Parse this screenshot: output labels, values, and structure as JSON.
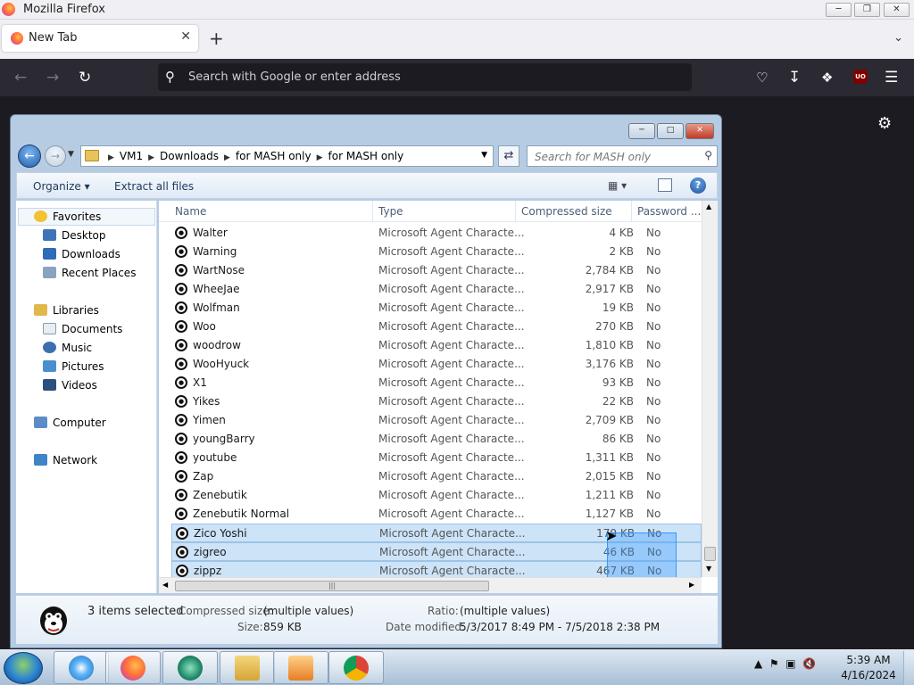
{
  "firefox": {
    "window_title": "Mozilla Firefox",
    "tab_label": "New Tab",
    "url_placeholder": "Search with Google or enter address",
    "ublock_badge": "UO"
  },
  "explorer": {
    "breadcrumbs": [
      "VM1",
      "Downloads",
      "for MASH only",
      "for MASH only"
    ],
    "search_placeholder": "Search for MASH only",
    "toolbar": {
      "organize": "Organize",
      "extract_all": "Extract all files"
    },
    "nav": {
      "favorites": "Favorites",
      "desktop": "Desktop",
      "downloads": "Downloads",
      "recent_places": "Recent Places",
      "libraries": "Libraries",
      "documents": "Documents",
      "music": "Music",
      "pictures": "Pictures",
      "videos": "Videos",
      "computer": "Computer",
      "network": "Network"
    },
    "columns": {
      "name": "Name",
      "type": "Type",
      "compressed_size": "Compressed size",
      "password": "Password ..."
    },
    "files": [
      {
        "name": "Walter",
        "type": "Microsoft Agent Characte...",
        "size": "4 KB",
        "password": "No"
      },
      {
        "name": "Warning",
        "type": "Microsoft Agent Characte...",
        "size": "2 KB",
        "password": "No"
      },
      {
        "name": "WartNose",
        "type": "Microsoft Agent Characte...",
        "size": "2,784 KB",
        "password": "No"
      },
      {
        "name": "WheeJae",
        "type": "Microsoft Agent Characte...",
        "size": "2,917 KB",
        "password": "No"
      },
      {
        "name": "Wolfman",
        "type": "Microsoft Agent Characte...",
        "size": "19 KB",
        "password": "No"
      },
      {
        "name": "Woo",
        "type": "Microsoft Agent Characte...",
        "size": "270 KB",
        "password": "No"
      },
      {
        "name": "woodrow",
        "type": "Microsoft Agent Characte...",
        "size": "1,810 KB",
        "password": "No"
      },
      {
        "name": "WooHyuck",
        "type": "Microsoft Agent Characte...",
        "size": "3,176 KB",
        "password": "No"
      },
      {
        "name": "X1",
        "type": "Microsoft Agent Characte...",
        "size": "93 KB",
        "password": "No"
      },
      {
        "name": "Yikes",
        "type": "Microsoft Agent Characte...",
        "size": "22 KB",
        "password": "No"
      },
      {
        "name": "Yimen",
        "type": "Microsoft Agent Characte...",
        "size": "2,709 KB",
        "password": "No"
      },
      {
        "name": "youngBarry",
        "type": "Microsoft Agent Characte...",
        "size": "86 KB",
        "password": "No"
      },
      {
        "name": "youtube",
        "type": "Microsoft Agent Characte...",
        "size": "1,311 KB",
        "password": "No"
      },
      {
        "name": "Zap",
        "type": "Microsoft Agent Characte...",
        "size": "2,015 KB",
        "password": "No"
      },
      {
        "name": "Zenebutik",
        "type": "Microsoft Agent Characte...",
        "size": "1,211 KB",
        "password": "No"
      },
      {
        "name": "Zenebutik Normal",
        "type": "Microsoft Agent Characte...",
        "size": "1,127 KB",
        "password": "No"
      },
      {
        "name": "Zico Yoshi",
        "type": "Microsoft Agent Characte...",
        "size": "179 KB",
        "password": "No",
        "selected": true
      },
      {
        "name": "zigreo",
        "type": "Microsoft Agent Characte...",
        "size": "46 KB",
        "password": "No",
        "selected": true
      },
      {
        "name": "zippz",
        "type": "Microsoft Agent Characte...",
        "size": "467 KB",
        "password": "No",
        "selected": true
      }
    ],
    "details": {
      "selection": "3 items selected",
      "compressed_label": "Compressed size:",
      "compressed_value": "(multiple values)",
      "size_label": "Size:",
      "size_value": "859 KB",
      "ratio_label": "Ratio:",
      "ratio_value": "(multiple values)",
      "date_label": "Date modified:",
      "date_value": "5/3/2017 8:49 PM - 7/5/2018 2:38 PM"
    }
  },
  "taskbar": {
    "time": "5:39 AM",
    "date": "4/16/2024"
  },
  "colors": {
    "selection": "#cce3f8",
    "firefox_dark": "#1c1b22",
    "taskbar": "#a8bfd6"
  }
}
